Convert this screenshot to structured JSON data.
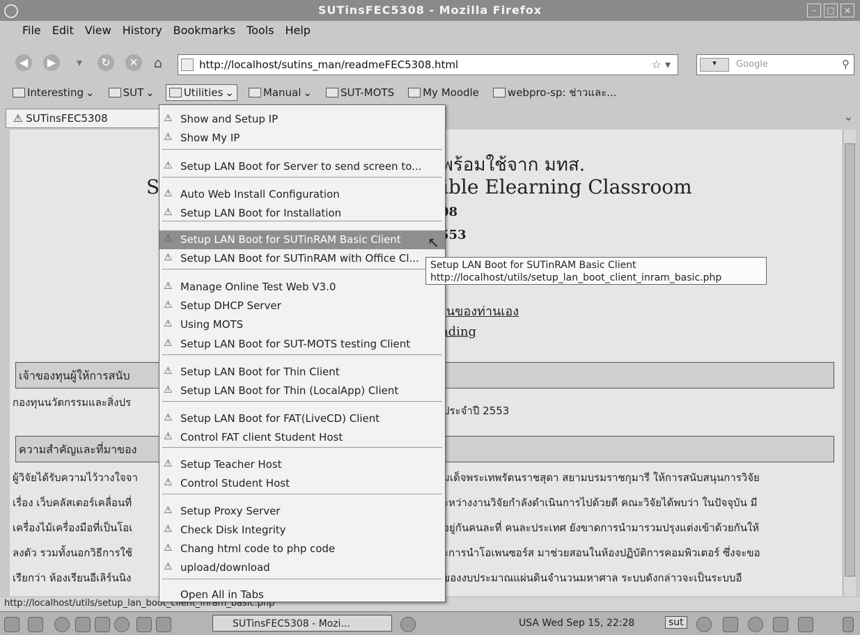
{
  "window": {
    "title": "SUTinsFEC5308 - Mozilla Firefox"
  },
  "menubar": [
    "File",
    "Edit",
    "View",
    "History",
    "Bookmarks",
    "Tools",
    "Help"
  ],
  "navigation": {
    "url": "http://localhost/sutins_man/readmeFEC5308.html",
    "search_placeholder": "Google"
  },
  "bookmarks": [
    {
      "label": "Interesting",
      "dropdown": true
    },
    {
      "label": "SUT",
      "dropdown": true
    },
    {
      "label": "Utilities",
      "dropdown": true,
      "active": true
    },
    {
      "label": "Manual",
      "dropdown": true
    },
    {
      "label": "SUT-MOTS",
      "dropdown": false
    },
    {
      "label": "My Moodle",
      "dropdown": false
    },
    {
      "label": "webpro-sp: ช่าวและ...",
      "dropdown": false
    }
  ],
  "tab": {
    "label": "SUTinsFEC5308"
  },
  "page": {
    "heading_th": "วพร้อมใช้จาก มทส.",
    "heading_en_prefix": "S",
    "heading_en": "ible Elearning Classroom",
    "line1": "08",
    "line2": "553",
    "link1": "ในของท่านเอง",
    "link2": "nding",
    "box1": "เจ้าของทุนผู้ให้การสนับ",
    "line_fund": "กองทุนนวัตกรรมและสิ่งปร",
    "line_fund_suffix": "ประจำปี 2553",
    "box2": "ความสำคัญและที่มาของ",
    "para": [
      "ผู้วิจัยได้รับความไว้วางใจจา",
      "เรื่อง เว็บคลัสเตอร์เคลื่อนที่",
      "เครื่องไม้เครื่องมือที่เป็นโอเ",
      "ลงตัว รวมทั้งนอกวิธีการใช้",
      "เรียกว่า ห้องเรียนอีเลิร์นนิง"
    ],
    "para_right": [
      "มเด็จพระเทพรัตนราชสุดา สยามบรมราชกุมารี ให้การสนับสนุนการวิจัย",
      "ะหว่างงานวิจัยกำลังดำเนินการไปด้วยดี คณะวิจัยได้พบว่า ในปัจจุบัน มี",
      "อยู่กันคนละที่ คนละประเทศ ยังขาดการนำมารวมปรุงแต่งเข้าด้วยกันให้",
      "ะการนำโอเพนซอร์ส มาช่วยสอนในห้องปฏิบัติการคอมพิวเตอร์ ซึ่งจะขอ",
      "ของงบประมาณแผ่นดินจำนวนมหาศาล ระบบดังกล่าวจะเป็นระบบอี"
    ]
  },
  "utilities_menu": [
    {
      "label": "Show and Setup IP"
    },
    {
      "label": "Show My IP"
    },
    {
      "label": "Setup LAN Boot for Server to send screen to..."
    },
    {
      "label": "Auto Web Install Configuration"
    },
    {
      "label": "Setup LAN Boot for Installation"
    },
    {
      "label": "Setup LAN Boot for SUTinRAM Basic Client",
      "highlighted": true
    },
    {
      "label": "Setup LAN Boot for SUTinRAM with Office Cl..."
    },
    {
      "label": "Manage Online Test Web V3.0"
    },
    {
      "label": "Setup DHCP Server"
    },
    {
      "label": "Using MOTS"
    },
    {
      "label": "Setup LAN Boot for SUT-MOTS testing Client"
    },
    {
      "label": "Setup LAN Boot for Thin Client"
    },
    {
      "label": "Setup LAN Boot for Thin (LocalApp) Client"
    },
    {
      "label": "Setup LAN Boot for FAT(LiveCD) Client"
    },
    {
      "label": "Control FAT client Student Host"
    },
    {
      "label": "Setup Teacher Host"
    },
    {
      "label": "Control Student Host"
    },
    {
      "label": "Setup Proxy Server"
    },
    {
      "label": "Check Disk Integrity"
    },
    {
      "label": "Chang html code to php code"
    },
    {
      "label": "upload/download"
    },
    {
      "label": "Open All in Tabs"
    }
  ],
  "tooltip": {
    "title": "Setup LAN Boot for SUTinRAM Basic Client",
    "url": "http://localhost/utils/setup_lan_boot_client_inram_basic.php"
  },
  "statusbar": {
    "text": "http://localhost/utils/setup_lan_boot_client_inram_basic.php"
  },
  "taskbar": {
    "window_button": "SUTinsFEC5308 - Mozi...",
    "clock": "USA Wed Sep 15, 22:28",
    "user": "sut"
  }
}
